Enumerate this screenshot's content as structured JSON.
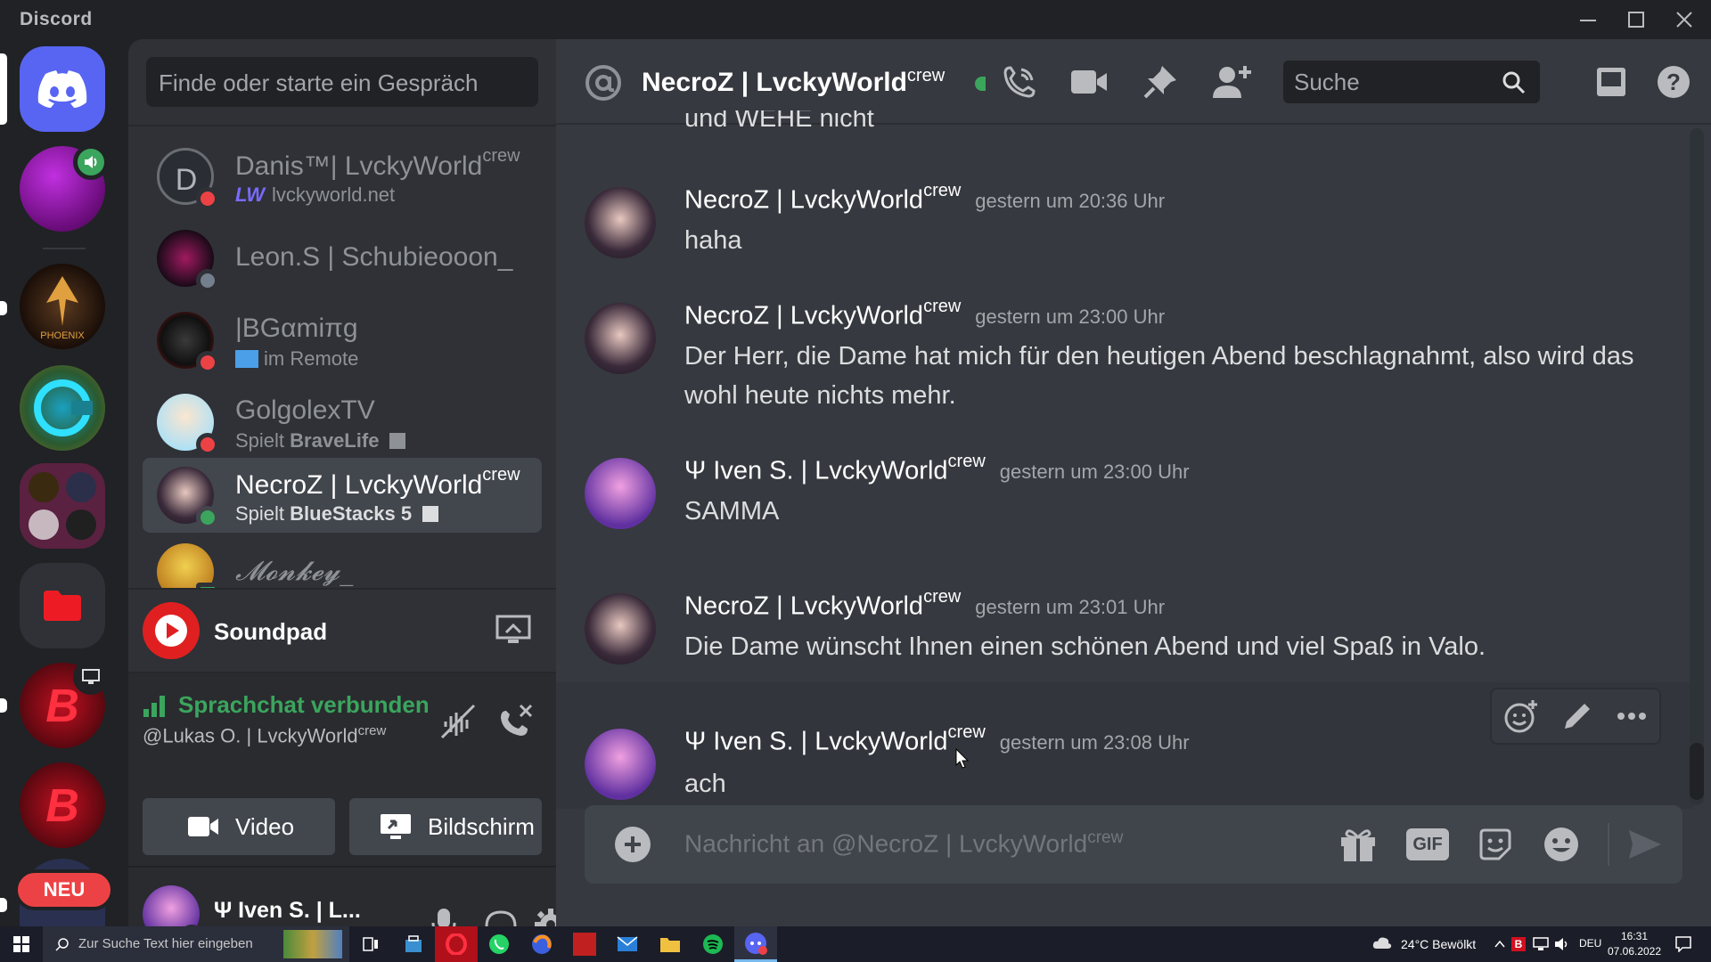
{
  "window": {
    "app_name": "Discord",
    "controls": [
      "minimize",
      "maximize",
      "close"
    ]
  },
  "servers": {
    "home_icon": "discord-logo-icon",
    "new_badge": "NEU"
  },
  "dm_sidebar": {
    "search_placeholder": "Finde oder starte ein Gespräch",
    "dms": [
      {
        "name": "Danis™| LvckyWorld",
        "tag": "crew",
        "sub": "lvckyworld.net",
        "status": "dnd",
        "selected": false
      },
      {
        "name": "Leon.S | Schubieooon_",
        "tag": "",
        "sub": "",
        "status": "offline",
        "selected": false
      },
      {
        "name": "|BGαmiπg",
        "tag": "",
        "sub": "im Remote",
        "status": "dnd",
        "selected": false
      },
      {
        "name": "GolgolexTV",
        "tag": "",
        "sub_prefix": "Spielt ",
        "sub_bold": "BraveLife",
        "status": "dnd",
        "selected": false
      },
      {
        "name": "NecroZ | LvckyWorld",
        "tag": "crew",
        "sub_prefix": "Spielt ",
        "sub_bold": "BlueStacks 5",
        "status": "online",
        "selected": true
      },
      {
        "name": "𝓜𝓸𝓷𝓴𝓮𝔂_",
        "tag": "",
        "sub": "",
        "status": "mobile",
        "selected": false
      }
    ],
    "soundpad_label": "Soundpad",
    "voice": {
      "status": "Sprachchat verbunden",
      "channel": "@Lukas O. | LvckyWorld",
      "channel_tag": "crew",
      "video_label": "Video",
      "screen_label": "Bildschirm"
    },
    "user": {
      "name": "Ψ Iven S. | L..."
    }
  },
  "chat": {
    "header_title": "NecroZ | LvckyWorld",
    "header_tag": "crew",
    "search_placeholder": "Suche",
    "cut_off_text": "und WEHE nicht",
    "messages": [
      {
        "author": "NecroZ | LvckyWorld",
        "tag": "crew",
        "time": "gestern um 20:36 Uhr",
        "text": "haha"
      },
      {
        "author": "NecroZ | LvckyWorld",
        "tag": "crew",
        "time": "gestern um 23:00 Uhr",
        "text": "Der Herr, die Dame hat mich für den heutigen Abend beschlagnahmt, also wird das wohl heute nichts mehr."
      },
      {
        "author": "Ψ Iven S. | LvckyWorld",
        "tag": "crew",
        "time": "gestern um 23:00 Uhr",
        "text": "SAMMA"
      },
      {
        "author": "NecroZ | LvckyWorld",
        "tag": "crew",
        "time": "gestern um 23:01 Uhr",
        "text": "Die Dame wünscht Ihnen einen schönen Abend und viel Spaß in Valo."
      },
      {
        "author": "Ψ Iven S. | LvckyWorld",
        "tag": "crew",
        "time": "gestern um 23:08 Uhr",
        "text": "ach"
      }
    ],
    "composer_placeholder": "Nachricht an @NecroZ | LvckyWorld",
    "composer_tag": "crew",
    "gif_label": "GIF"
  },
  "taskbar": {
    "search_placeholder": "Zur Suche Text hier eingeben",
    "weather": "24°C  Bewölkt",
    "language": "DEU",
    "time": "16:31",
    "date": "07.06.2022"
  },
  "colors": {
    "online": "#3ba55d",
    "dnd": "#ed4245",
    "offline": "#747f8d",
    "blurple": "#5865f2"
  }
}
